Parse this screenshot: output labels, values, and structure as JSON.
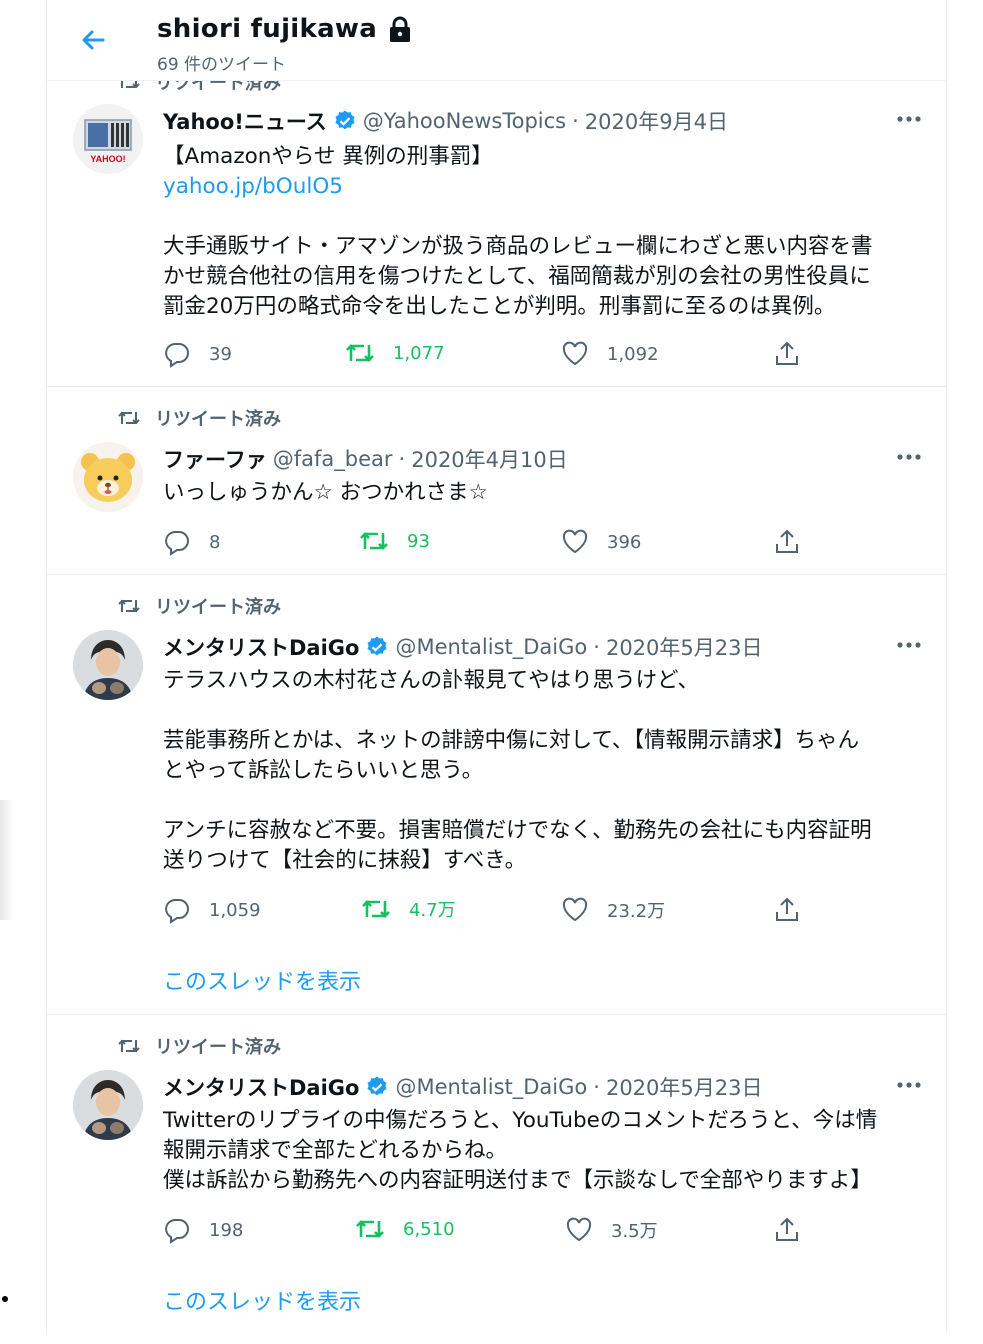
{
  "profile": {
    "name": "shiori fujikawa",
    "tweet_count": "69 件のツイート"
  },
  "tweets": [
    {
      "retweet_label": "リツイート済み",
      "name": "Yahoo!ニュース",
      "verified": true,
      "handle": "@YahooNewsTopics",
      "date": "2020年9月4日",
      "lines": [
        "【Amazonやらせ 異例の刑事罰】"
      ],
      "link": "yahoo.jp/bOulO5",
      "lines2": [
        "大手通販サイト・アマゾンが扱う商品のレビュー欄にわざと悪い内容を書",
        "かせ競合他社の信用を傷つけたとして、福岡簡裁が別の会社の男性役員に",
        "罰金20万円の略式命令を出したことが判明。刑事罰に至るのは異例。"
      ],
      "replies": "39",
      "retweets": "1,077",
      "likes": "1,092"
    },
    {
      "retweet_label": "リツイート済み",
      "name": "ファーファ",
      "verified": false,
      "handle": "@fafa_bear",
      "date": "2020年4月10日",
      "lines": [
        "いっしゅうかん☆ おつかれさま☆"
      ],
      "replies": "8",
      "retweets": "93",
      "likes": "396"
    },
    {
      "retweet_label": "リツイート済み",
      "name": "メンタリストDaiGo",
      "verified": true,
      "handle": "@Mentalist_DaiGo",
      "date": "2020年5月23日",
      "para1": [
        "テラスハウスの木村花さんの訃報見てやはり思うけど、"
      ],
      "para2": [
        "芸能事務所とかは、ネットの誹謗中傷に対して、【情報開示請求】ちゃん",
        "とやって訴訟したらいいと思う。"
      ],
      "para3": [
        "アンチに容赦など不要。損害賠償だけでなく、勤務先の会社にも内容証明",
        "送りつけて【社会的に抹殺】すべき。"
      ],
      "replies": "1,059",
      "retweets": "4.7万",
      "likes": "23.2万",
      "thread_label": "このスレッドを表示"
    },
    {
      "retweet_label": "リツイート済み",
      "name": "メンタリストDaiGo",
      "verified": true,
      "handle": "@Mentalist_DaiGo",
      "date": "2020年5月23日",
      "lines": [
        "Twitterのリプライの中傷だろうと、YouTubeのコメントだろうと、今は情",
        "報開示請求で全部たどれるからね。",
        "僕は訴訟から勤務先への内容証明送付まで【示談なしで全部やりますよ】"
      ],
      "replies": "198",
      "retweets": "6,510",
      "likes": "3.5万",
      "thread_label": "このスレッドを表示"
    }
  ],
  "colors": {
    "accent": "#1d9bf0",
    "retweet": "#17bf63",
    "secondary_text": "#536471",
    "verified": "#1d9bf0"
  },
  "icons": [
    "back-arrow-icon",
    "lock-icon",
    "retweet-icon",
    "verified-icon",
    "more-icon",
    "reply-icon",
    "like-icon",
    "share-icon"
  ]
}
